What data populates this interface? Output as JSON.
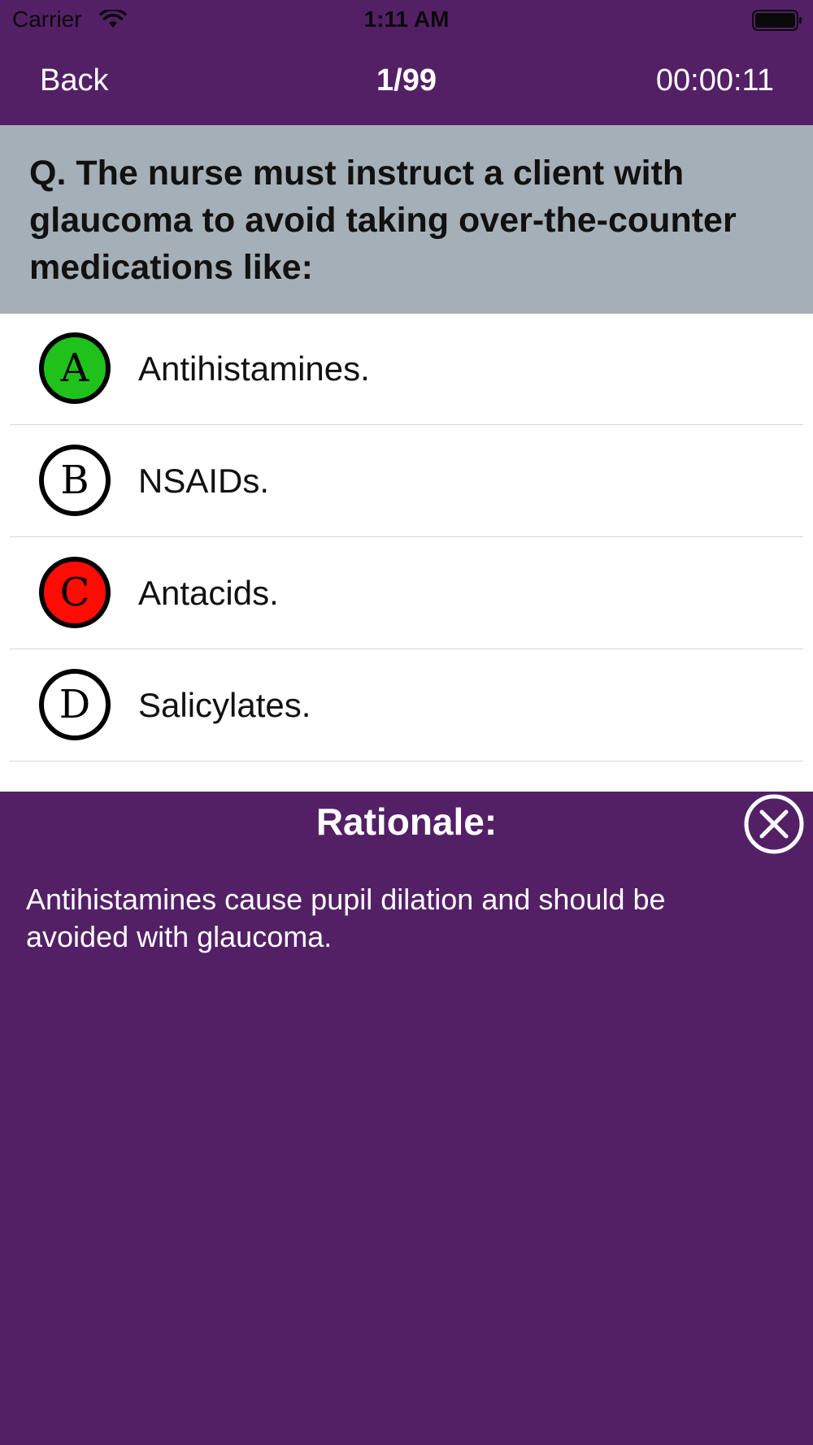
{
  "status_bar": {
    "carrier": "Carrier",
    "time": "1:11 AM",
    "wifi_icon": "wifi-icon",
    "battery_icon": "battery-full-icon"
  },
  "nav": {
    "back_label": "Back",
    "counter": "1/99",
    "timer": "00:00:11"
  },
  "question": {
    "text": "Q. The nurse must instruct a client with glaucoma to avoid taking over-the-counter medications like:"
  },
  "options": [
    {
      "letter": "A",
      "label": "Antihistamines.",
      "badge_color": "#1fc21a",
      "state": "correct"
    },
    {
      "letter": "B",
      "label": "NSAIDs.",
      "badge_color": "#ffffff",
      "state": "neutral"
    },
    {
      "letter": "C",
      "label": "Antacids.",
      "badge_color": "#ff0c05",
      "state": "incorrect"
    },
    {
      "letter": "D",
      "label": "Salicylates.",
      "badge_color": "#ffffff",
      "state": "neutral"
    }
  ],
  "rationale": {
    "title": "Rationale:",
    "text": "Antihistamines cause pupil dilation and should be avoided with glaucoma.",
    "close_icon": "close-circle-icon"
  },
  "colors": {
    "primary": "#532066",
    "question_bg": "#a5afb7",
    "correct": "#1fc21a",
    "incorrect": "#ff0c05"
  }
}
